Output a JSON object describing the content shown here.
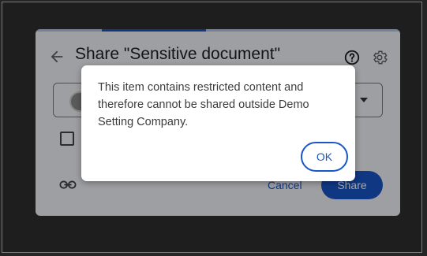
{
  "share_dialog": {
    "title": "Share \"Sensitive document\"",
    "cancel_label": "Cancel",
    "share_label": "Share",
    "icons": {
      "back": "arrow-back-icon",
      "help": "help-icon",
      "settings": "gear-icon",
      "link": "link-icon",
      "dropdown": "caret-down-icon"
    }
  },
  "alert": {
    "message": "This item contains restricted content and therefore cannot be shared outside Demo Setting Company.",
    "ok_label": "OK"
  },
  "colors": {
    "accent": "#1a56c8",
    "dialog_bg": "#f3f5f9",
    "alert_bg": "#ffffff"
  }
}
